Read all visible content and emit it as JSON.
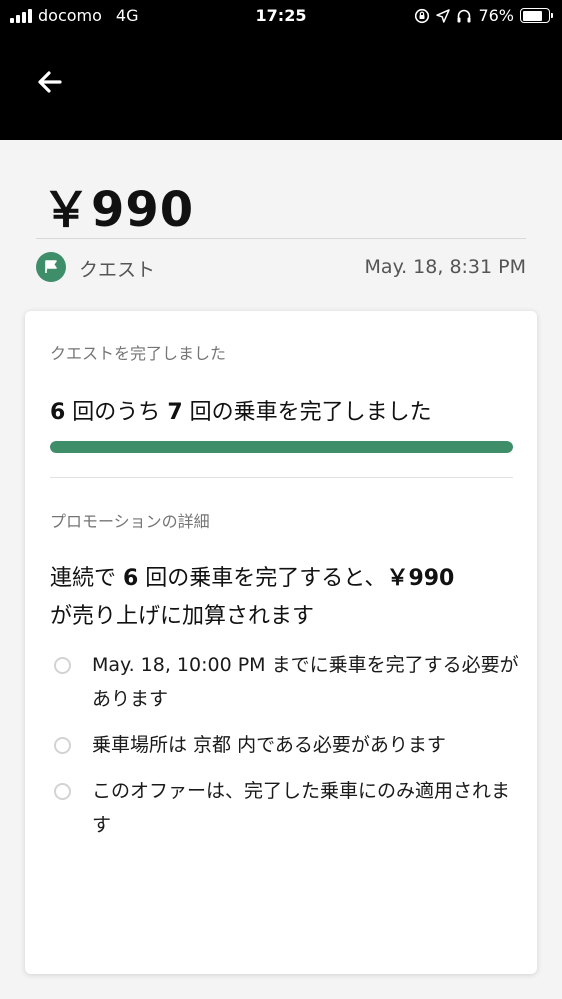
{
  "status_bar": {
    "carrier": "docomo",
    "network": "4G",
    "time": "17:25",
    "battery_percent": "76%",
    "battery_level": 0.76,
    "icons": [
      "signal-bars-icon",
      "orientation-lock-icon",
      "location-arrow-icon",
      "headphones-icon",
      "battery-icon"
    ]
  },
  "header": {
    "back_icon": "back-arrow-icon"
  },
  "trip": {
    "amount": "￥990",
    "category_icon": "flag-icon",
    "category": "クエスト",
    "date": "May. 18, 8:31 PM"
  },
  "quest_card": {
    "status_label": "クエストを完了しました",
    "progress": {
      "completed": "6",
      "total": "7",
      "text_pre": "",
      "text_mid": " 回のうち ",
      "text_post": " 回の乗車を完了しました",
      "fill_fraction": 1.0
    },
    "promo_section_label": "プロモーションの詳細",
    "promo_description": {
      "part1": "連続で ",
      "rides": "6",
      "part2": " 回の乗車を完了すると、",
      "bonus": "￥990",
      "part3": "が売り上げに加算されます"
    },
    "conditions": [
      "May. 18, 10:00 PM までに乗車を完了する必要があります",
      "乗車場所は 京都 内である必要があります",
      "このオファーは、完了した乗車にのみ適用されます"
    ]
  },
  "colors": {
    "accent_green": "#3e8e6a",
    "header_bg": "#000000",
    "page_bg": "#f4f4f4"
  }
}
